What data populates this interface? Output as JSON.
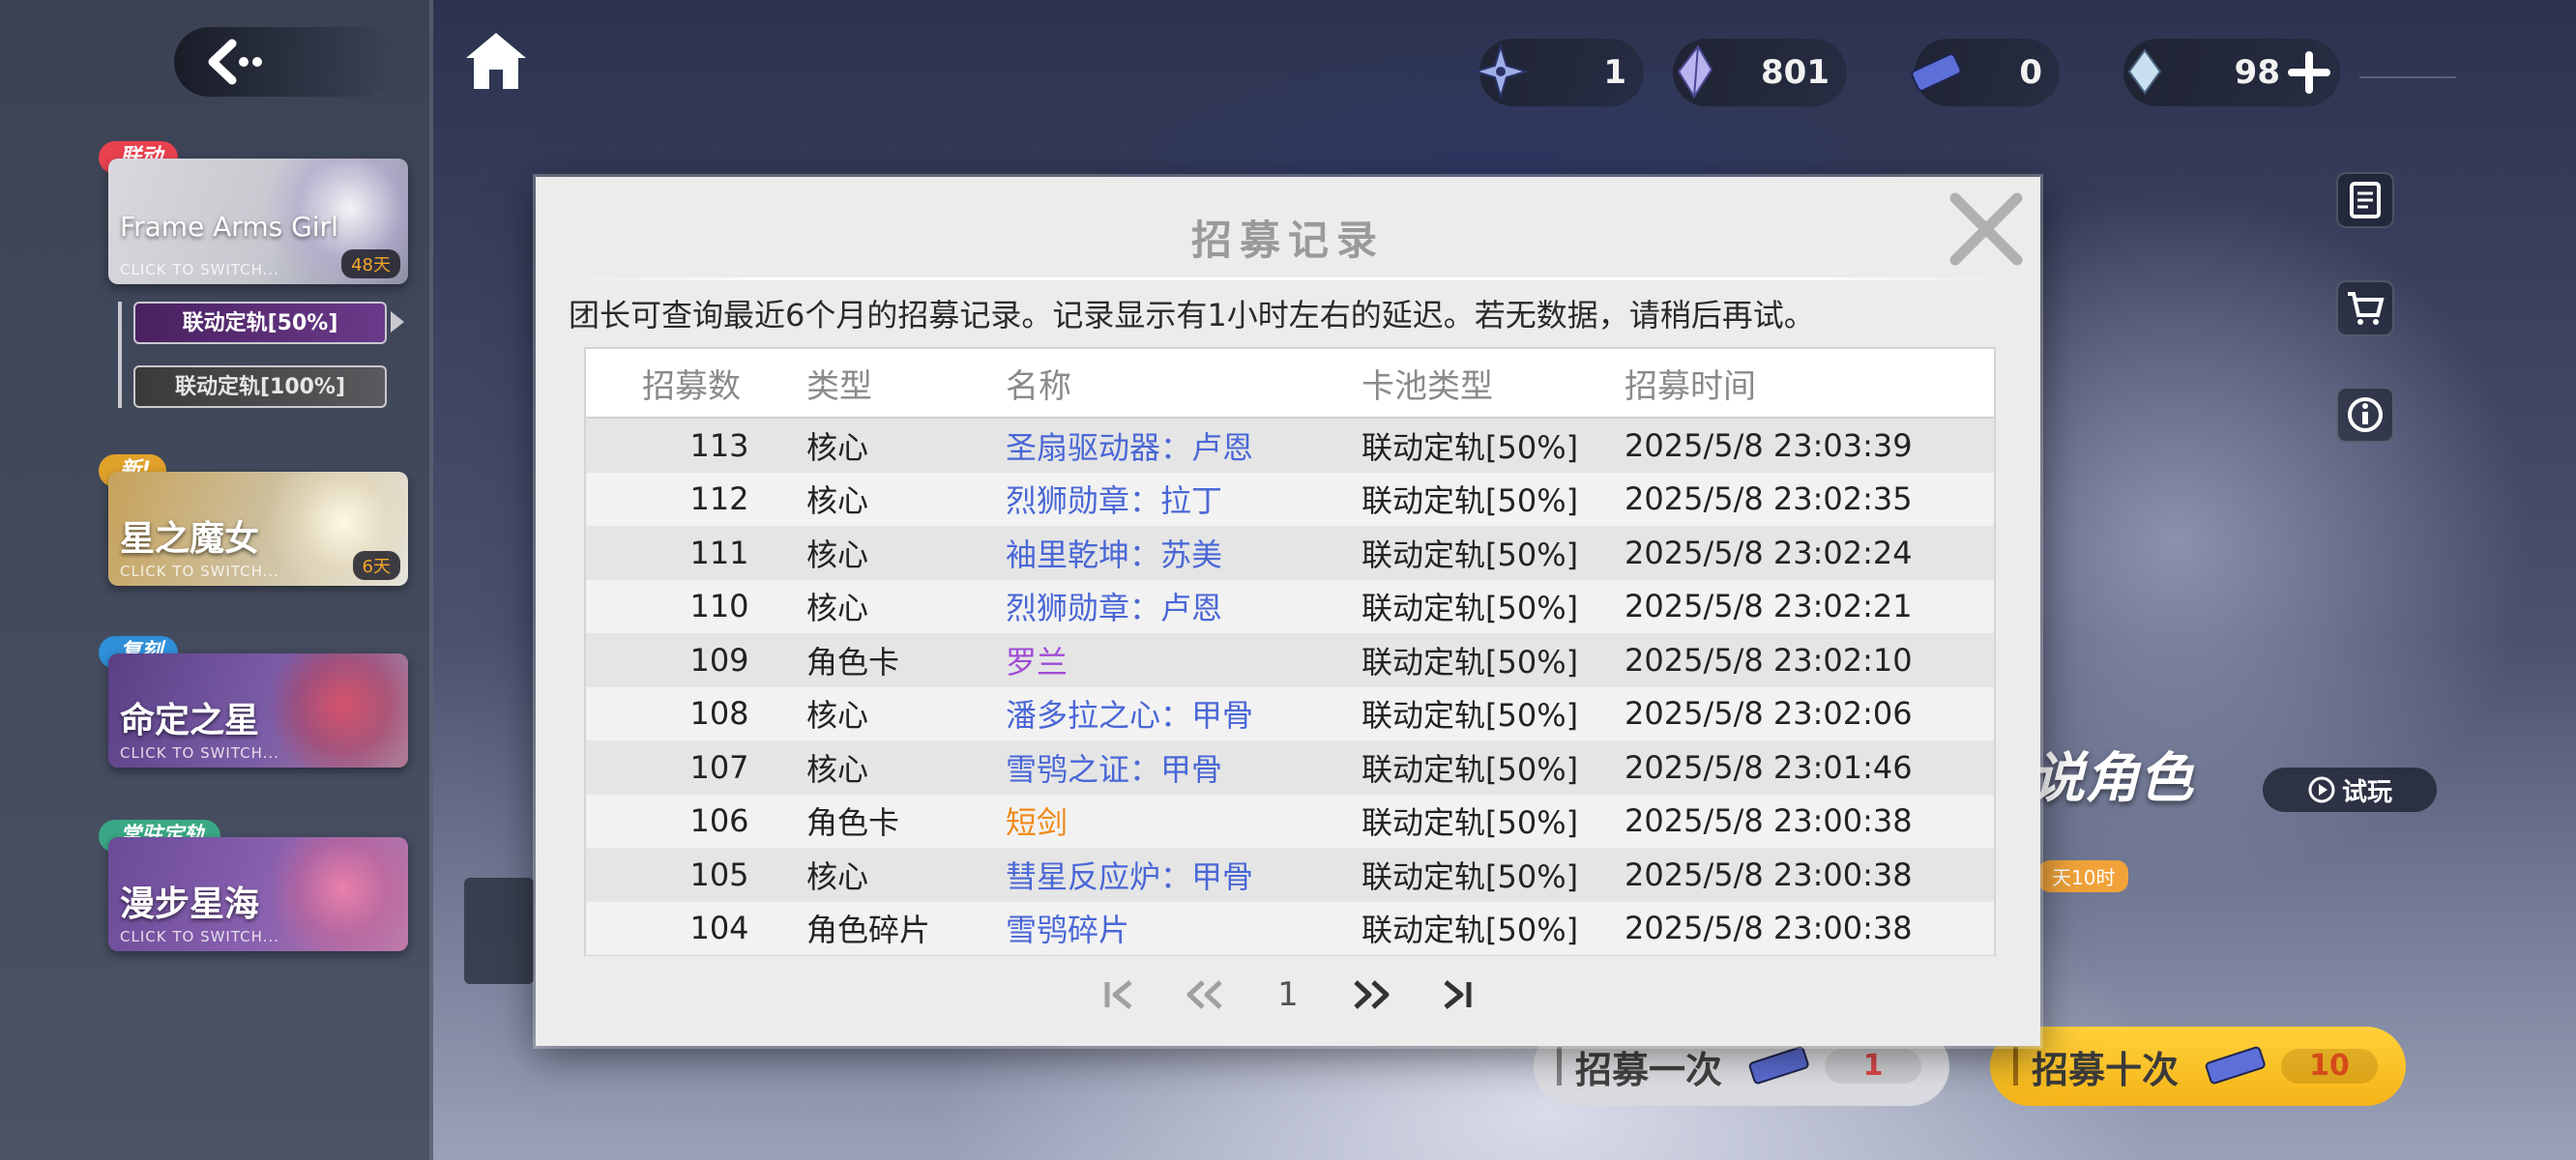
{
  "left_panel": {
    "banners": [
      {
        "tag": "联动",
        "tag_color": "#e8424f",
        "name": "Frame Arms Girl",
        "sub": "CLICK TO SWITCH...",
        "days": "48天"
      },
      {
        "tag": "新!",
        "tag_color": "#e0a12a",
        "name": "星之魔女",
        "sub": "CLICK TO SWITCH...",
        "days": "6天"
      },
      {
        "tag": "复刻",
        "tag_color": "#2f8fd8",
        "name": "命定之星",
        "sub": "CLICK TO SWITCH..."
      },
      {
        "tag": "常驻定轨",
        "tag_color": "#3aa886",
        "name": "漫步星海",
        "sub": "CLICK TO SWITCH..."
      }
    ],
    "sub_tabs": [
      "联动定轨[50%]",
      "联动定轨[100%]"
    ]
  },
  "resources": [
    {
      "icon": "shuriken-icon",
      "value": "1"
    },
    {
      "icon": "crystal-icon",
      "value": "801"
    },
    {
      "icon": "ticket-icon",
      "value": "0"
    },
    {
      "icon": "gem-icon",
      "value": "98"
    }
  ],
  "background": {
    "character_label": "说角色",
    "trial_button": "试玩",
    "time_tag": "天10时"
  },
  "pull_buttons": {
    "one": {
      "label": "招募一次",
      "cost": "1"
    },
    "ten": {
      "label": "招募十次",
      "cost": "10"
    }
  },
  "modal": {
    "title": "招募记录",
    "notice": "团长可查询最近6个月的招募记录。记录显示有1小时左右的延迟。若无数据，请稍后再试。",
    "columns": [
      "招募数",
      "类型",
      "名称",
      "卡池类型",
      "招募时间"
    ],
    "rows": [
      {
        "num": "113",
        "type": "核心",
        "name": "圣扇驱动器：卢恩",
        "color": "#4a67d6",
        "pool": "联动定轨[50%]",
        "time": "2025/5/8 23:03:39"
      },
      {
        "num": "112",
        "type": "核心",
        "name": "烈狮勋章：拉丁",
        "color": "#4a67d6",
        "pool": "联动定轨[50%]",
        "time": "2025/5/8 23:02:35"
      },
      {
        "num": "111",
        "type": "核心",
        "name": "袖里乾坤：苏美",
        "color": "#4a67d6",
        "pool": "联动定轨[50%]",
        "time": "2025/5/8 23:02:24"
      },
      {
        "num": "110",
        "type": "核心",
        "name": "烈狮勋章：卢恩",
        "color": "#4a67d6",
        "pool": "联动定轨[50%]",
        "time": "2025/5/8 23:02:21"
      },
      {
        "num": "109",
        "type": "角色卡",
        "name": "罗兰",
        "color": "#a04ad6",
        "pool": "联动定轨[50%]",
        "time": "2025/5/8 23:02:10"
      },
      {
        "num": "108",
        "type": "核心",
        "name": "潘多拉之心：甲骨",
        "color": "#4a67d6",
        "pool": "联动定轨[50%]",
        "time": "2025/5/8 23:02:06"
      },
      {
        "num": "107",
        "type": "核心",
        "name": "雪鸮之证：甲骨",
        "color": "#4a67d6",
        "pool": "联动定轨[50%]",
        "time": "2025/5/8 23:01:46"
      },
      {
        "num": "106",
        "type": "角色卡",
        "name": "短剑",
        "color": "#f08a1a",
        "pool": "联动定轨[50%]",
        "time": "2025/5/8 23:00:38"
      },
      {
        "num": "105",
        "type": "核心",
        "name": "彗星反应炉：甲骨",
        "color": "#4a67d6",
        "pool": "联动定轨[50%]",
        "time": "2025/5/8 23:00:38"
      },
      {
        "num": "104",
        "type": "角色碎片",
        "name": "雪鸮碎片",
        "color": "#4a67d6",
        "pool": "联动定轨[50%]",
        "time": "2025/5/8 23:00:38"
      }
    ],
    "pager": {
      "current": "1"
    }
  }
}
